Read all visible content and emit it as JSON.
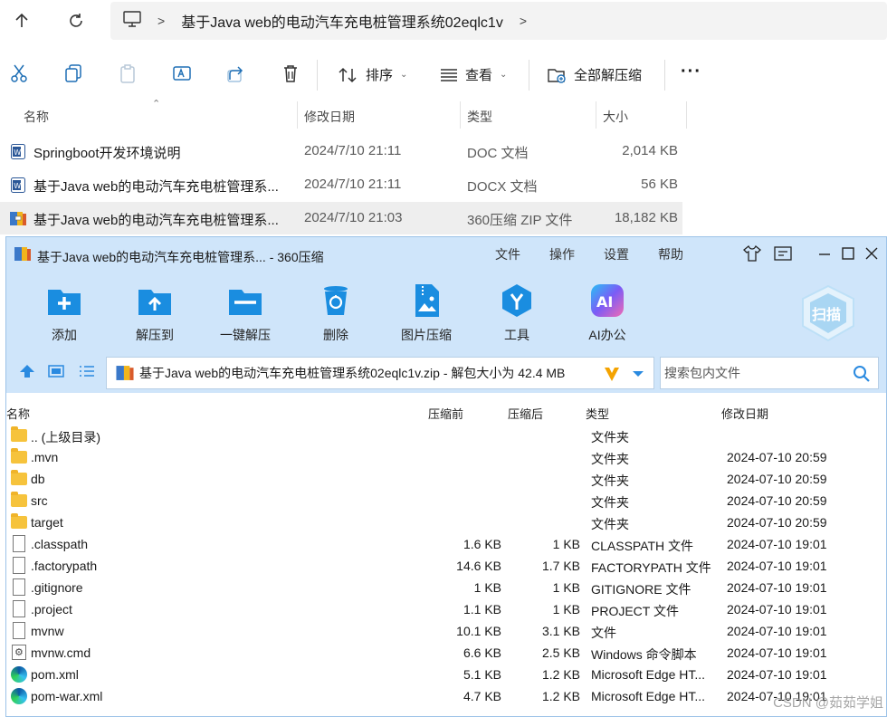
{
  "explorer": {
    "path": "基于Java web的电动汽车充电桩管理系统02eqlc1v",
    "commands": {
      "sort": "排序",
      "view": "查看",
      "extract_all": "全部解压缩",
      "more": "···"
    },
    "columns": {
      "name": "名称",
      "modified": "修改日期",
      "type": "类型",
      "size": "大小"
    },
    "files": [
      {
        "name": "Springboot开发环境说明",
        "modified": "2024/7/10 21:11",
        "type": "DOC 文档",
        "size": "2,014 KB",
        "icon": "word-doc-icon"
      },
      {
        "name": "基于Java web的电动汽车充电桩管理系...",
        "modified": "2024/7/10 21:11",
        "type": "DOCX 文档",
        "size": "56 KB",
        "icon": "word-doc-icon"
      },
      {
        "name": "基于Java web的电动汽车充电桩管理系...",
        "modified": "2024/7/10 21:03",
        "type": "360压缩 ZIP 文件",
        "size": "18,182 KB",
        "icon": "zip-archive-icon"
      }
    ]
  },
  "archiver": {
    "title": "基于Java web的电动汽车充电桩管理系... - 360压缩",
    "menu": [
      "文件",
      "操作",
      "设置",
      "帮助"
    ],
    "toolbar": [
      {
        "label": "添加",
        "icon": "add-icon"
      },
      {
        "label": "解压到",
        "icon": "extract-to-icon"
      },
      {
        "label": "一键解压",
        "icon": "one-click-extract-icon"
      },
      {
        "label": "删除",
        "icon": "delete-icon"
      },
      {
        "label": "图片压缩",
        "icon": "image-compress-icon"
      },
      {
        "label": "工具",
        "icon": "tools-icon"
      },
      {
        "label": "AI办公",
        "icon": "ai-office-icon"
      }
    ],
    "scan_label": "扫描",
    "path_text": "基于Java web的电动汽车充电桩管理系统02eqlc1v.zip - 解包大小为 42.4 MB",
    "search_placeholder": "搜索包内文件",
    "columns": {
      "name": "名称",
      "before": "压缩前",
      "after": "压缩后",
      "type": "类型",
      "modified": "修改日期"
    },
    "entries": [
      {
        "name": ".. (上级目录)",
        "before": "",
        "after": "",
        "type": "文件夹",
        "modified": "",
        "icon": "folder-icon"
      },
      {
        "name": ".mvn",
        "before": "",
        "after": "",
        "type": "文件夹",
        "modified": "2024-07-10 20:59",
        "icon": "folder-icon"
      },
      {
        "name": "db",
        "before": "",
        "after": "",
        "type": "文件夹",
        "modified": "2024-07-10 20:59",
        "icon": "folder-icon"
      },
      {
        "name": "src",
        "before": "",
        "after": "",
        "type": "文件夹",
        "modified": "2024-07-10 20:59",
        "icon": "folder-icon"
      },
      {
        "name": "target",
        "before": "",
        "after": "",
        "type": "文件夹",
        "modified": "2024-07-10 20:59",
        "icon": "folder-icon"
      },
      {
        "name": ".classpath",
        "before": "1.6 KB",
        "after": "1 KB",
        "type": "CLASSPATH 文件",
        "modified": "2024-07-10 19:01",
        "icon": "file-icon"
      },
      {
        "name": ".factorypath",
        "before": "14.6 KB",
        "after": "1.7 KB",
        "type": "FACTORYPATH 文件",
        "modified": "2024-07-10 19:01",
        "icon": "file-icon"
      },
      {
        "name": ".gitignore",
        "before": "1 KB",
        "after": "1 KB",
        "type": "GITIGNORE 文件",
        "modified": "2024-07-10 19:01",
        "icon": "file-icon"
      },
      {
        "name": ".project",
        "before": "1.1 KB",
        "after": "1 KB",
        "type": "PROJECT 文件",
        "modified": "2024-07-10 19:01",
        "icon": "file-icon"
      },
      {
        "name": "mvnw",
        "before": "10.1 KB",
        "after": "3.1 KB",
        "type": "文件",
        "modified": "2024-07-10 19:01",
        "icon": "file-icon"
      },
      {
        "name": "mvnw.cmd",
        "before": "6.6 KB",
        "after": "2.5 KB",
        "type": "Windows 命令脚本",
        "modified": "2024-07-10 19:01",
        "icon": "cmd-script-icon"
      },
      {
        "name": "pom.xml",
        "before": "5.1 KB",
        "after": "1.2 KB",
        "type": "Microsoft Edge HT...",
        "modified": "2024-07-10 19:01",
        "icon": "edge-icon"
      },
      {
        "name": "pom-war.xml",
        "before": "4.7 KB",
        "after": "1.2 KB",
        "type": "Microsoft Edge HT...",
        "modified": "2024-07-10 19:01",
        "icon": "edge-icon"
      }
    ]
  },
  "watermark": "CSDN @茹茹学姐"
}
